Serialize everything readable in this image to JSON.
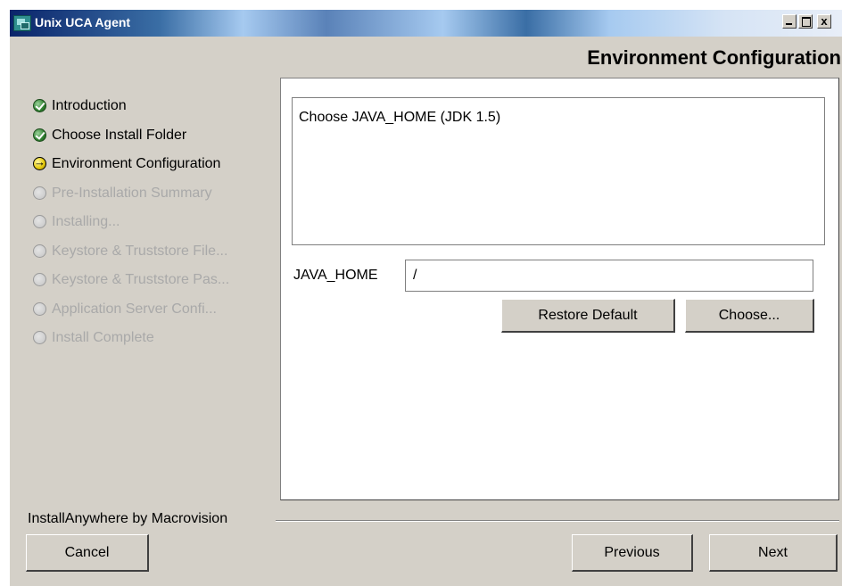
{
  "window": {
    "title": "Unix UCA Agent",
    "close_glyph": "x"
  },
  "page_heading": "Environment Configuration",
  "steps": [
    {
      "label": "Introduction",
      "status": "done"
    },
    {
      "label": "Choose Install Folder",
      "status": "done"
    },
    {
      "label": "Environment Configuration",
      "status": "current"
    },
    {
      "label": "Pre-Installation Summary",
      "status": "pending"
    },
    {
      "label": "Installing...",
      "status": "pending"
    },
    {
      "label": "Keystore & Truststore File...",
      "status": "pending"
    },
    {
      "label": "Keystore & Truststore Pas...",
      "status": "pending"
    },
    {
      "label": "Application Server  Confi...",
      "status": "pending"
    },
    {
      "label": "Install Complete",
      "status": "pending"
    }
  ],
  "content": {
    "message": "Choose JAVA_HOME (JDK 1.5)",
    "java_home_label": "JAVA_HOME",
    "java_home_value": "/",
    "restore_default_label": "Restore Default",
    "choose_label": "Choose..."
  },
  "footer": {
    "brand": "InstallAnywhere by Macrovision",
    "cancel_label": "Cancel",
    "previous_label": "Previous",
    "next_label": "Next"
  },
  "colors": {
    "window_bg": "#d4d0c8",
    "title_bar_start": "#0a246a",
    "pending_text": "#a9a9a9"
  }
}
